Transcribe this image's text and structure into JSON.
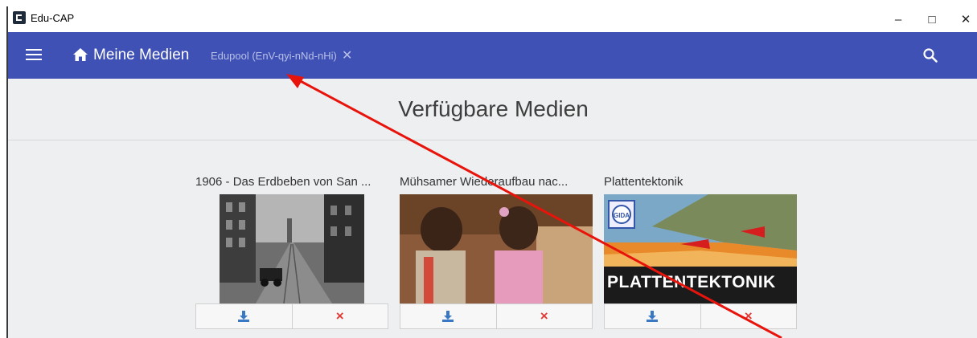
{
  "window": {
    "title": "Edu-CAP",
    "minimize": "–",
    "maximize": "□",
    "close": "✕"
  },
  "appbar": {
    "home_label": "Meine Medien",
    "chip_label": "Edupool (EnV-qyi-nNd-nHi)",
    "chip_close": "✕"
  },
  "main": {
    "title": "Verfügbare Medien",
    "media": [
      {
        "title": "1906 - Das Erdbeben von San ...",
        "thumbnail": "black-and-white-street-photo"
      },
      {
        "title": "Mühsamer Wiederaufbau nac...",
        "thumbnail": "children-photo"
      },
      {
        "title": "Plattentektonik",
        "thumbnail": "tectonic-plates-illustration",
        "thumbnail_text": "PLATTENTEKTONIK",
        "logo_text": "GIDA"
      }
    ],
    "download_icon": "download-icon",
    "delete_icon": "×"
  },
  "colors": {
    "appbar": "#3f51b5",
    "download": "#3a78c4",
    "delete": "#e53935",
    "annotation_arrow": "#e8140c"
  }
}
